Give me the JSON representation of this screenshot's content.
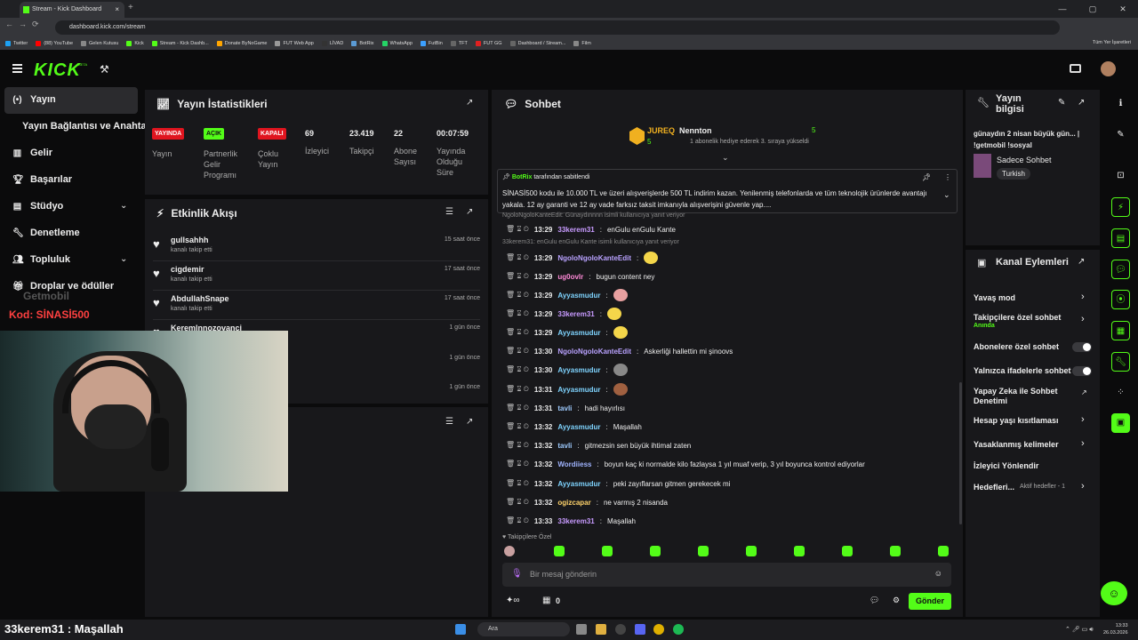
{
  "browser": {
    "tab_title": "Stream - Kick Dashboard",
    "url": "dashboard.kick.com/stream",
    "bookmarks": [
      "Twitter",
      "(88) YouTube",
      "Gelen Kutusu",
      "Kick",
      "Stream - Kick Dashb...",
      "Donate ByNoGame",
      "FUT Web App",
      "LİVAD",
      "BotRix",
      "WhatsApp",
      "FutBin",
      "TFT",
      "FUT GG",
      "Dashboard / Stream...",
      "Film"
    ],
    "bookmarks_right": "Tüm Yer İşaretleri"
  },
  "app": {
    "logo": "KICK",
    "logo_badge": "BETA"
  },
  "sidebar": {
    "items": [
      {
        "label": "Yayın"
      },
      {
        "label": "Yayın Bağlantısı ve Anahtarı"
      },
      {
        "label": "Gelir"
      },
      {
        "label": "Başarılar"
      },
      {
        "label": "Stüdyo"
      },
      {
        "label": "Denetleme"
      },
      {
        "label": "Topluluk"
      },
      {
        "label": "Droplar ve ödüller"
      }
    ],
    "overlay_code": "Kod: SİNASİ500",
    "overlay_brand": "Getmobil"
  },
  "stats": {
    "title": "Yayın İstatistikleri",
    "badges": [
      {
        "text": "YAYINDA",
        "label": "Yayın",
        "color": "#e0151f"
      },
      {
        "text": "AÇIK",
        "label": "Partnerlik Gelir Programı",
        "color": "#53fc18"
      },
      {
        "text": "KAPALI",
        "label": "Çoklu Yayın",
        "color": "#e0151f"
      }
    ],
    "values": [
      {
        "value": "69",
        "label": "İzleyici"
      },
      {
        "value": "23.419",
        "label": "Takipçi"
      },
      {
        "value": "22",
        "label": "Abone Sayısı"
      },
      {
        "value": "00:07:59",
        "label": "Yayında Olduğu Süre"
      }
    ]
  },
  "feed": {
    "title": "Etkinlik Akışı",
    "items": [
      {
        "name": "gullsahhh",
        "sub": "kanalı takip etti",
        "time": "15 saat önce"
      },
      {
        "name": "cigdemir",
        "sub": "kanalı takip etti",
        "time": "17 saat önce"
      },
      {
        "name": "AbdullahSnape",
        "sub": "kanalı takip etti",
        "time": "17 saat önce"
      },
      {
        "name": "Keremlnnozovanci",
        "sub": "",
        "time": "1 gün önce"
      },
      {
        "name": "",
        "sub": "",
        "time": "1 gün önce"
      },
      {
        "name": "",
        "sub": "",
        "time": "1 gün önce"
      }
    ]
  },
  "chat": {
    "title": "Sohbet",
    "top_gifter": {
      "name": "JUREQ",
      "count": "5"
    },
    "sub_gifter": {
      "name": "Nennton",
      "count": "5",
      "note": "1 abonelik hediye ederek 3. sıraya yükseldi"
    },
    "pinned": {
      "by": "BotRix",
      "by_suffix": "tarafından sabitlendi",
      "text": "SİNASİ500 kodu ile 10.000 TL ve üzeri alışverişlerde 500 TL indirim kazan.  Yenilenmiş telefonlarda ve tüm teknolojik ürünlerde avantajı yakala. 12 ay garanti ve 12 ay vade farksız taksit imkanıyla alışverişini güvenle yap...."
    },
    "reply_1": "NgoloNgoloKanteEdit: Günaydınnnn isimli kullanıcıya yanıt veriyor",
    "reply_2": "33kerem31: enGulu enGulu Kante isimli kullanıcıya yanıt veriyor",
    "messages": [
      {
        "time": "13:29",
        "user": "33kerem31",
        "color": "#c89bff",
        "text": "enGulu enGulu Kante",
        "emote": false
      },
      {
        "time": "13:29",
        "user": "NgoloNgoloKanteEdit",
        "color": "#b9a2ff",
        "text": "",
        "emote": true
      },
      {
        "time": "13:29",
        "user": "ug0ovlr",
        "color": "#ff8ad8",
        "text": "bugun content ney",
        "emote": false
      },
      {
        "time": "13:29",
        "user": "Ayyasmudur",
        "color": "#7fd4ff",
        "text": "",
        "emote": true
      },
      {
        "time": "13:29",
        "user": "33kerem31",
        "color": "#c89bff",
        "text": "",
        "emote": true
      },
      {
        "time": "13:29",
        "user": "Ayyasmudur",
        "color": "#7fd4ff",
        "text": "",
        "emote": true
      },
      {
        "time": "13:30",
        "user": "NgoloNgoloKanteEdit",
        "color": "#b9a2ff",
        "text": "Askerliği hallettin mi şinoovs",
        "emote": false
      },
      {
        "time": "13:30",
        "user": "Ayyasmudur",
        "color": "#7fd4ff",
        "text": "",
        "emote": true
      },
      {
        "time": "13:31",
        "user": "Ayyasmudur",
        "color": "#7fd4ff",
        "text": "",
        "emote": true
      },
      {
        "time": "13:31",
        "user": "tavli",
        "color": "#9ecbff",
        "text": "hadi hayırlısı",
        "emote": false
      },
      {
        "time": "13:32",
        "user": "Ayyasmudur",
        "color": "#7fd4ff",
        "text": "Maşallah",
        "emote": false
      },
      {
        "time": "13:32",
        "user": "tavli",
        "color": "#9ecbff",
        "text": "gitmezsin sen büyük ihtimal zaten",
        "emote": false
      },
      {
        "time": "13:32",
        "user": "Wordiiess",
        "color": "#a0b4ff",
        "text": "boyun kaç ki normalde kilo fazlaysa 1 yıl muaf verip, 3 yıl boyunca kontrol ediyorlar",
        "emote": false
      },
      {
        "time": "13:32",
        "user": "Ayyasmudur",
        "color": "#7fd4ff",
        "text": "peki zayıflarsan gitmen gerekecek mi",
        "emote": false
      },
      {
        "time": "13:32",
        "user": "ogizcapar",
        "color": "#ffd36b",
        "text": "ne varmış 2 nisanda",
        "emote": false
      },
      {
        "time": "13:33",
        "user": "33kerem31",
        "color": "#c89bff",
        "text": "Maşallah",
        "emote": false
      }
    ],
    "followers_only": "Takipçilere Özel",
    "input_placeholder": "Bir mesaj gönderin",
    "points": "0",
    "send_label": "Gönder"
  },
  "stream_info": {
    "title": "Yayın bilgisi",
    "stream_title": "günaydın 2 nisan büyük gün... | !getmobil !sosyal",
    "category": "Sadece Sohbet",
    "tag": "Turkish"
  },
  "channel_actions": {
    "title": "Kanal Eylemleri",
    "items": [
      {
        "label": "Yavaş mod",
        "kind": "chevron"
      },
      {
        "label": "Takipçilere özel sohbet",
        "kind": "chevron",
        "sub": "Anında"
      },
      {
        "label": "Abonelere özel sohbet",
        "kind": "toggle"
      },
      {
        "label": "Yalnızca ifadelerle sohbet",
        "kind": "toggle"
      },
      {
        "label": "Yapay Zeka ile Sohbet Denetimi",
        "kind": "link"
      },
      {
        "label": "Hesap yaşı kısıtlaması",
        "kind": "chevron"
      },
      {
        "label": "Yasaklanmış kelimeler",
        "kind": "chevron"
      },
      {
        "label": "İzleyici Yönlendir",
        "kind": "none"
      },
      {
        "label": "Hedefleri...",
        "kind": "chevron",
        "sub": "Aktif hedefler - 1"
      }
    ]
  },
  "overlay_caption": "33kerem31 : Maşallah",
  "taskbar": {
    "search": "Ara",
    "time": "13:33",
    "date": "26.03.2026"
  },
  "colors": {
    "accent": "#53fc18",
    "panel": "#18181b",
    "bg": "#0b0b0c"
  }
}
